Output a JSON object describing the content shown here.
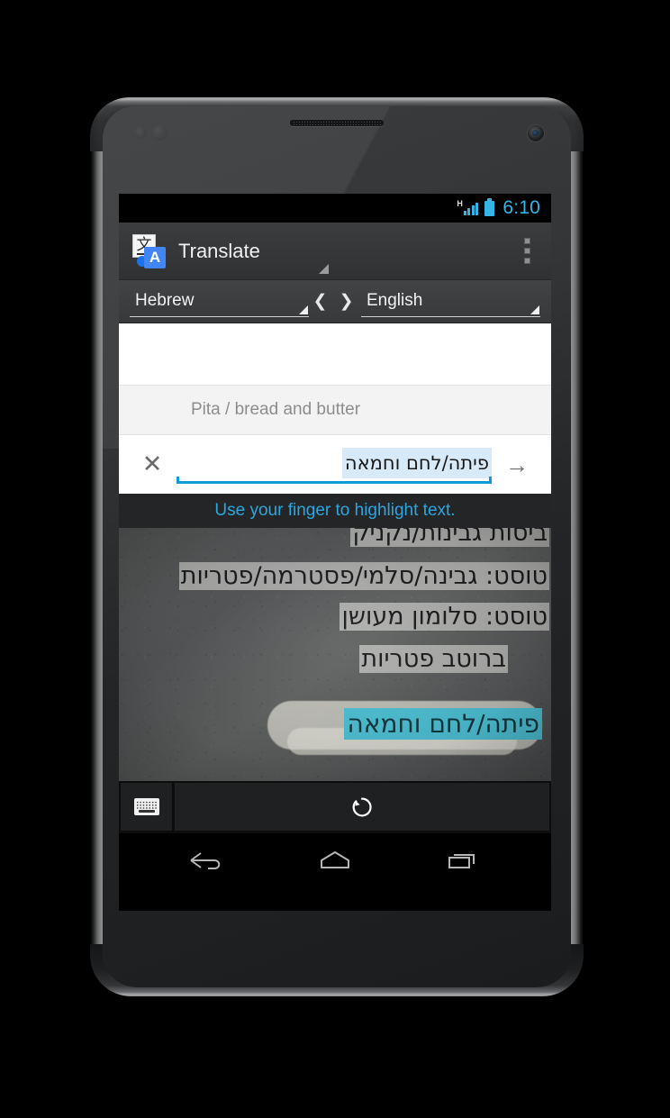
{
  "device": {
    "name": "android-phone",
    "frame_color": "#2b2d2f"
  },
  "statusbar": {
    "network_type": "H",
    "signal_icon": "signal-bars-icon",
    "battery_icon": "battery-full-icon",
    "time": "6:10",
    "accent_color": "#33b5e5"
  },
  "actionbar": {
    "app_icon": "translate-app-icon",
    "icon_card_glyph": "文",
    "icon_badge_glyph": "A",
    "title": "Translate",
    "overflow_icon": "overflow-menu-icon"
  },
  "language_bar": {
    "source_language": "Hebrew",
    "swap_icon": "swap-languages-icon",
    "swap_glyph": "❮ ❯",
    "target_language": "English"
  },
  "translation": {
    "output_text": "",
    "source_detected_text": "Pita / bread and butter"
  },
  "input": {
    "clear_icon": "clear-x-icon",
    "clear_glyph": "✕",
    "value": "פיתה/לחם וחמאה",
    "submit_icon": "submit-arrow-icon",
    "submit_glyph": "→",
    "underline_color": "#0f9bd7",
    "selection_color": "#d8e9f8"
  },
  "hint": {
    "text": "Use your finger to highlight text.",
    "color": "#2ca6e0"
  },
  "camera": {
    "name": "camera-ocr-view",
    "menu_lines": [
      "ביסות גבינות/נקניק",
      "טוסט: גבינה/סלמי/פסטרמה/פטריות",
      "טוסט: סלומון מעושן",
      "ברוטב פטריות"
    ],
    "highlighted_text": "פיתה/לחם וחמאה",
    "highlight_color": "#4ec4d8",
    "swipe_trail": "finger-swipe-trail"
  },
  "controls": {
    "keyboard_icon": "keyboard-icon",
    "shutter_icon": "refresh-rescan-icon"
  },
  "navbar": {
    "back_icon": "back-icon",
    "home_icon": "home-icon",
    "recents_icon": "recents-icon"
  }
}
